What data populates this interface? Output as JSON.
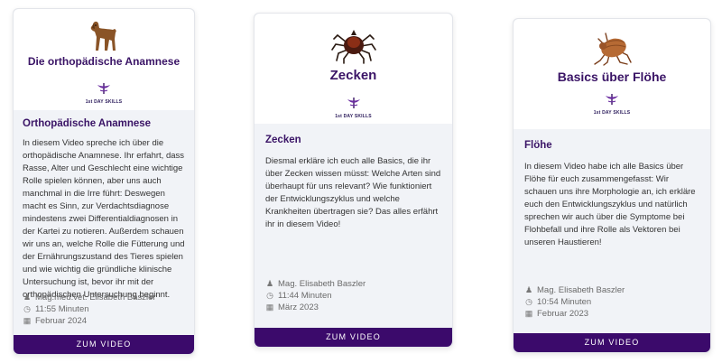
{
  "cards": [
    {
      "hero_title": "Die orthopädische Anamnese",
      "animal_icon": "dog-icon",
      "logo_text": "1st DAY SKILLS",
      "title": "Orthopädische Anamnese",
      "description": "In diesem Video spreche ich über die orthopädische Anamnese. Ihr erfahrt, dass Rasse, Alter und Geschlecht eine wichtige Rolle spielen können, aber uns auch manchmal in die Irre führt: Deswegen macht es Sinn, zur Verdachtsdiagnose mindestens zwei Differentialdiagnosen in der Kartei zu notieren. Außerdem schauen wir uns an, welche Rolle die Fütterung und der Ernährungszustand des Tieres spielen und wie wichtig die gründliche klinische Untersuchung ist, bevor ihr mit der orthopädischen Untersuchung beginnt.",
      "author": "Mag.med.vet. Elisabeth Baszler",
      "duration": "11:55 Minuten",
      "date": "Februar 2024",
      "button": "ZUM VIDEO"
    },
    {
      "hero_title": "Zecken",
      "animal_icon": "tick-icon",
      "logo_text": "1st DAY SKILLS",
      "title": "Zecken",
      "description": "Diesmal erkläre ich euch alle Basics, die ihr über Zecken wissen müsst: Welche Arten sind überhaupt für uns relevant? Wie funktioniert der Entwicklungszyklus und welche Krankheiten übertragen sie? Das alles erfährt ihr in diesem Video!",
      "author": "Mag. Elisabeth Baszler",
      "duration": "11:44 Minuten",
      "date": "März 2023",
      "button": "ZUM VIDEO"
    },
    {
      "hero_title": "Basics über Flöhe",
      "animal_icon": "flea-icon",
      "logo_text": "1st DAY SKILLS",
      "title": "Flöhe",
      "description": "In diesem Video habe ich alle Basics über Flöhe für euch zusammengefasst: Wir schauen uns ihre Morphologie an, ich erkläre euch den Entwicklungszyklus und natürlich sprechen wir auch über die Symptome bei Flohbefall und ihre Rolle als Vektoren bei unseren Haustieren!",
      "author": "Mag. Elisabeth Baszler",
      "duration": "10:54 Minuten",
      "date": "Februar 2023",
      "button": "ZUM VIDEO"
    }
  ]
}
